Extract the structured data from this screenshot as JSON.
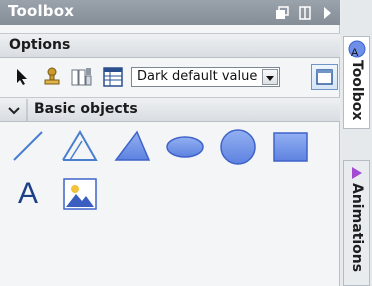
{
  "panel": {
    "title": "Toolbox",
    "title_icons": [
      "restore-icon",
      "pin-icon",
      "expand-arrow-icon"
    ]
  },
  "options": {
    "heading": "Options",
    "tools": [
      "pointer-icon",
      "stamp-icon",
      "properties-icon",
      "table-view-icon"
    ],
    "dropdown_value": "Dark default value",
    "layout_button": "layout-toggle-icon"
  },
  "basic_objects": {
    "heading": "Basic objects",
    "text_glyph": "A",
    "items": [
      "line-icon",
      "polyline-icon",
      "polygon-icon",
      "ellipse-icon",
      "circle-icon",
      "rectangle-icon",
      "text-field-icon",
      "graphic-view-icon"
    ]
  },
  "sidebar": {
    "tabs": [
      {
        "label": "Toolbox",
        "active": true
      },
      {
        "label": "Animations",
        "active": false
      }
    ]
  },
  "colors": {
    "titlebar": "#8f97a1",
    "shape_fill": "#6d8fe8",
    "shape_stroke": "#3f63c9",
    "accent": "#4a7fd0"
  }
}
